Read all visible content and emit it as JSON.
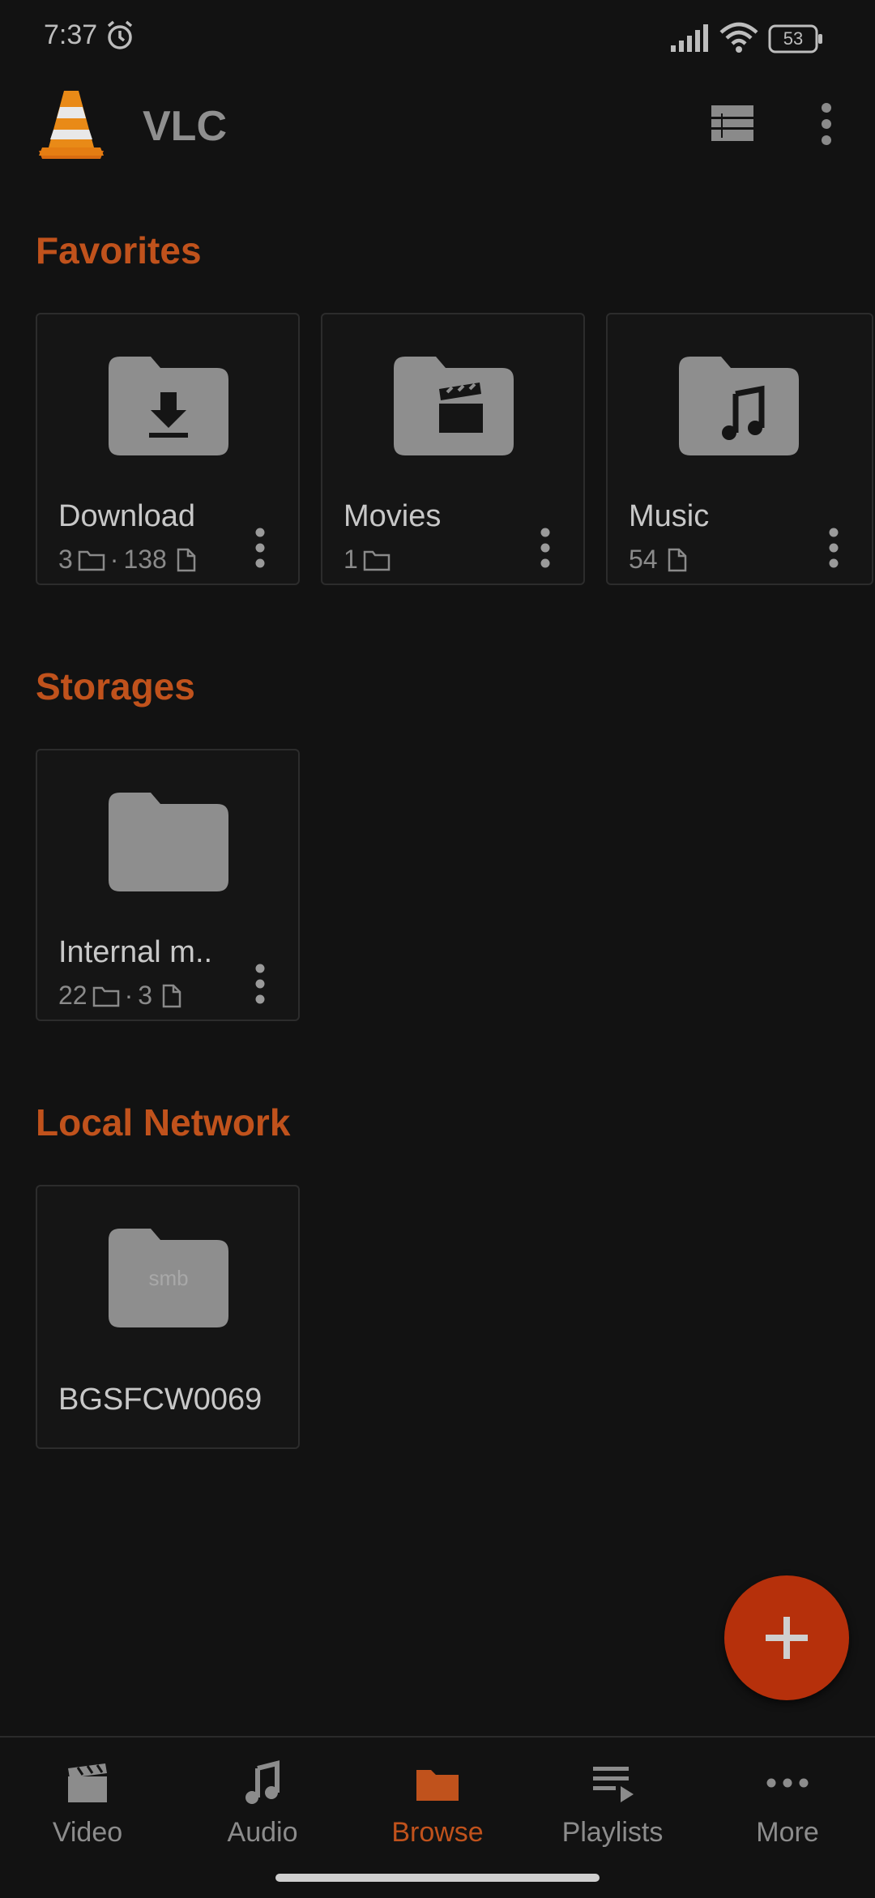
{
  "status_bar": {
    "time": "7:37",
    "battery": "53"
  },
  "app_bar": {
    "title": "VLC"
  },
  "sections": {
    "favorites": "Favorites",
    "storages": "Storages",
    "local_network": "Local Network"
  },
  "favorites": [
    {
      "name": "Download",
      "folders": "3",
      "sep": "·",
      "files": "138",
      "icon": "download-folder-icon"
    },
    {
      "name": "Movies",
      "folders": "1",
      "icon": "movies-folder-icon"
    },
    {
      "name": "Music",
      "files": "54",
      "icon": "music-folder-icon"
    }
  ],
  "storages": [
    {
      "name": "Internal m..",
      "folders": "22",
      "sep": "·",
      "files": "3",
      "icon": "folder-icon"
    }
  ],
  "network": [
    {
      "name": "BGSFCW0069",
      "folder_text": "smb",
      "icon": "smb-folder-icon"
    }
  ],
  "bottom_nav": [
    {
      "label": "Video",
      "icon": "video-icon"
    },
    {
      "label": "Audio",
      "icon": "audio-icon"
    },
    {
      "label": "Browse",
      "icon": "browse-folder-icon",
      "active": true
    },
    {
      "label": "Playlists",
      "icon": "playlists-icon"
    },
    {
      "label": "More",
      "icon": "more-dots-icon"
    }
  ],
  "colors": {
    "accent": "#c0521c",
    "fab": "#b6300b",
    "background": "#121212",
    "folder": "#8e8e8e"
  }
}
